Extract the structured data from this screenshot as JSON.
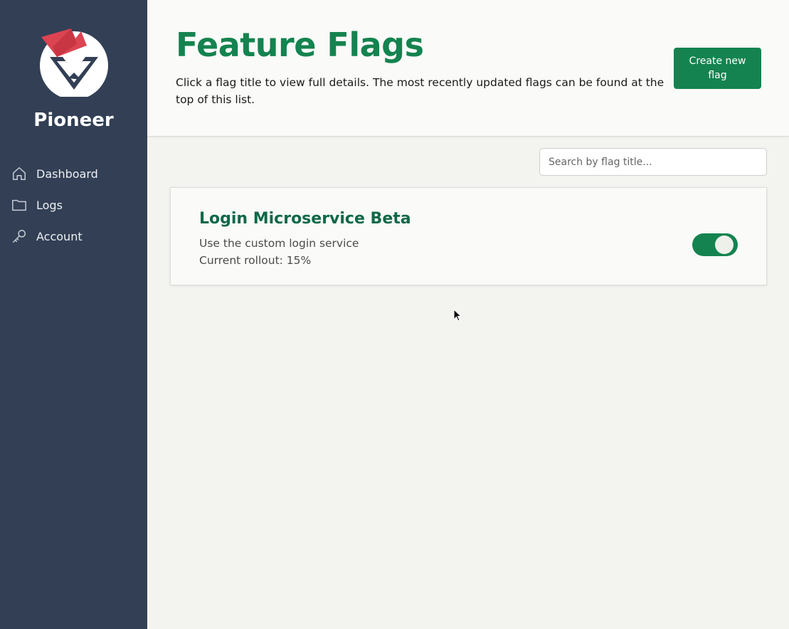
{
  "sidebar": {
    "brand": "Pioneer",
    "items": [
      {
        "label": "Dashboard",
        "icon": "home-icon"
      },
      {
        "label": "Logs",
        "icon": "folder-icon"
      },
      {
        "label": "Account",
        "icon": "key-icon"
      }
    ]
  },
  "header": {
    "title": "Feature Flags",
    "subtitle": "Click a flag title to view full details. The most recently updated flags can be found at the top of this list.",
    "create_button": "Create new flag"
  },
  "search": {
    "placeholder": "Search by flag title..."
  },
  "flags": [
    {
      "title": "Login Microservice Beta",
      "description": "Use the custom login service",
      "rollout": "Current rollout: 15%",
      "enabled": true
    }
  ],
  "colors": {
    "sidebar_bg": "#323f55",
    "accent_green": "#14834f",
    "flag_title": "#11684a",
    "logo_red": "#dc4452"
  }
}
